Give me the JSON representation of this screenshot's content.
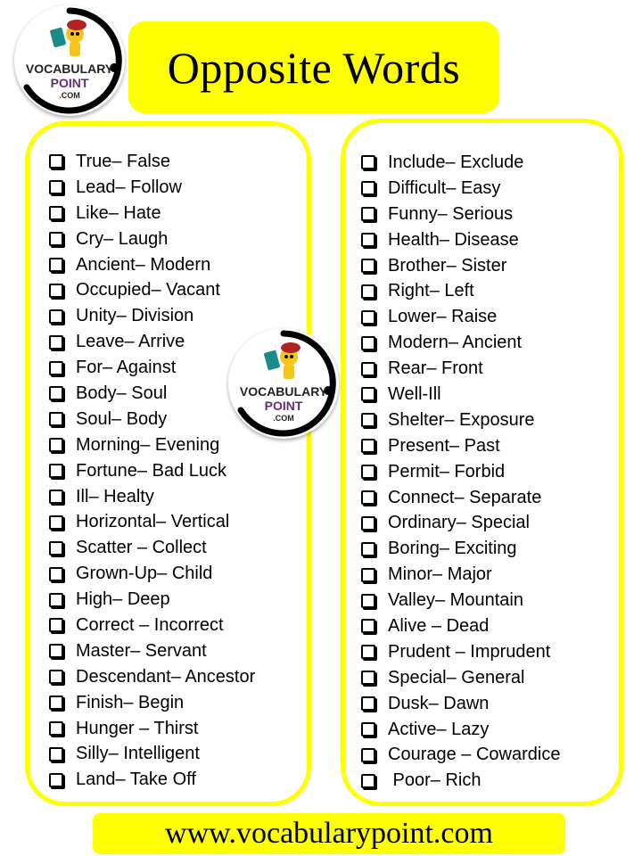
{
  "header": {
    "title": "Opposite Words",
    "logo": {
      "line1": "VOCABULARY",
      "line2": "POINT",
      "line3": ".COM"
    }
  },
  "colors": {
    "accent": "#ffff00",
    "logo_purple": "#6a2a7a",
    "text": "#000000"
  },
  "icons": {
    "bullet": "checkbox-icon"
  },
  "left_list": [
    "True– False",
    "Lead– Follow",
    "Like– Hate",
    "Cry– Laugh",
    "Ancient– Modern",
    "Occupied– Vacant",
    "Unity– Division",
    "Leave– Arrive",
    "For– Against",
    "Body– Soul",
    "Soul– Body",
    "Morning– Evening",
    "Fortune– Bad Luck",
    "Ill– Healty",
    "Horizontal– Vertical",
    "Scatter – Collect",
    "Grown-Up– Child",
    "High– Deep",
    "Correct – Incorrect",
    "Master– Servant",
    "Descendant– Ancestor",
    "Finish– Begin",
    "Hunger – Thirst",
    "Silly– Intelligent",
    "Land– Take Off"
  ],
  "right_list": [
    "Include– Exclude",
    "Difficult– Easy",
    "Funny– Serious",
    "Health– Disease",
    "Brother– Sister",
    "Right– Left",
    "Lower– Raise",
    "Modern– Ancient",
    "Rear– Front",
    "Well-Ill",
    "Shelter– Exposure",
    "Present– Past",
    "Permit– Forbid",
    "Connect– Separate",
    "Ordinary– Special",
    "Boring– Exciting",
    "Minor– Major",
    "Valley– Mountain",
    "Alive – Dead",
    "Prudent – Imprudent",
    "Special– General",
    "Dusk– Dawn",
    "Active– Lazy",
    "Courage – Cowardice",
    " Poor– Rich"
  ],
  "footer": {
    "url": "www.vocabularypoint.com"
  }
}
